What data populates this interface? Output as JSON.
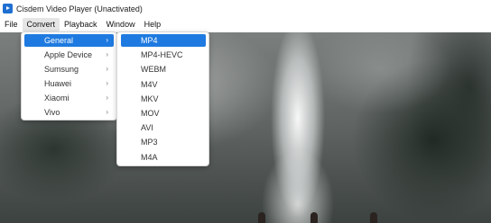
{
  "window": {
    "title": "Cisdem Video Player (Unactivated)"
  },
  "menubar": {
    "items": [
      "File",
      "Convert",
      "Playback",
      "Window",
      "Help"
    ],
    "active": "Convert"
  },
  "convert_menu": {
    "items": [
      {
        "label": "General",
        "has_submenu": true,
        "selected": true
      },
      {
        "label": "Apple Device",
        "has_submenu": true,
        "selected": false
      },
      {
        "label": "Sumsung",
        "has_submenu": true,
        "selected": false
      },
      {
        "label": "Huawei",
        "has_submenu": true,
        "selected": false
      },
      {
        "label": "Xiaomi",
        "has_submenu": true,
        "selected": false
      },
      {
        "label": "Vivo",
        "has_submenu": true,
        "selected": false
      }
    ],
    "arrow_glyph": "›"
  },
  "format_menu": {
    "items": [
      {
        "label": "MP4",
        "selected": true
      },
      {
        "label": "MP4-HEVC",
        "selected": false
      },
      {
        "label": "WEBM",
        "selected": false
      },
      {
        "label": "M4V",
        "selected": false
      },
      {
        "label": "MKV",
        "selected": false
      },
      {
        "label": "MOV",
        "selected": false
      },
      {
        "label": "AVI",
        "selected": false
      },
      {
        "label": "MP3",
        "selected": false
      },
      {
        "label": "M4A",
        "selected": false
      }
    ]
  },
  "colors": {
    "accent": "#1e7ae0",
    "menu_bg": "#ffffff"
  }
}
